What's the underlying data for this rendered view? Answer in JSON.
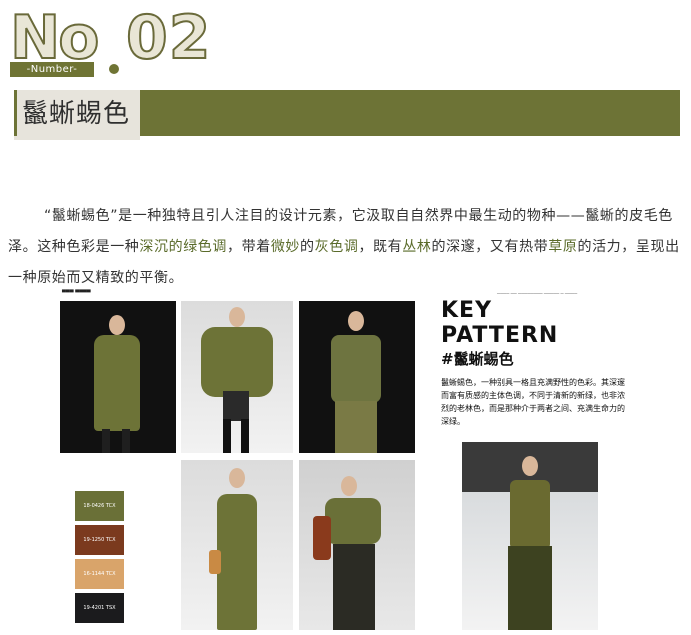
{
  "header": {
    "no_text": "No",
    "number_text": "02",
    "number_label": "-Number-"
  },
  "title": "鬣蜥蜴色",
  "paragraph": {
    "segments": [
      "“鬣蜥蜴色”是一种独特且引人注目的设计元素，它汲取自自然界中最生动的物种——鬣蜥的皮毛色泽。这种色彩是一种",
      "深沉的绿色调",
      "，带着",
      "微妙",
      "的",
      "灰色调",
      "，既有",
      "丛林",
      "的深邃，又有热带",
      "草原",
      "的活力，呈现出一种原始而又精致的平衡。"
    ]
  },
  "collage": {
    "swatches": [
      {
        "code": "18-0426 TCX",
        "color": "#6a7037"
      },
      {
        "code": "19-1250 TCX",
        "color": "#7b3a1e"
      },
      {
        "code": "16-1144 TCX",
        "color": "#d9a46a"
      },
      {
        "code": "19-4201 TSX",
        "color": "#1b1b1d"
      }
    ],
    "key_pattern_title": "KEY\nPATTERN",
    "key_pattern_subtitle": "#鬣蜥蜴色",
    "key_pattern_body": "鬣蜥蜴色，一种别具一格且充满野性的色彩。其深邃而富有质感的主体色调，不同于清新的新绿，也非浓烈的老林色，而是那种介于两者之间、充满生命力的深绿。"
  },
  "colors": {
    "accent": "#6d7336",
    "title_box": "#e7e4dc"
  }
}
